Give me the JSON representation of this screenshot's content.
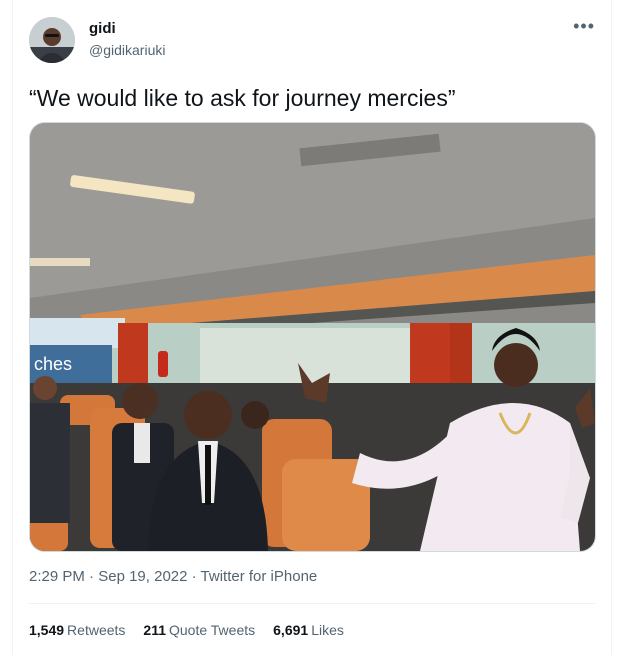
{
  "author": {
    "display_name": "gidi",
    "handle": "@gidikariuki"
  },
  "tweet": {
    "text": "“We would like to ask for journey mercies”",
    "time": "2:29 PM",
    "sep1": "·",
    "date": "Sep 19, 2022",
    "sep2": "·",
    "source": "Twitter for iPhone"
  },
  "more_menu": {
    "icon": "more-dots-icon",
    "glyph": "•••"
  },
  "media": {
    "bus_sign_text": "ches"
  },
  "stats": {
    "retweets_count": "1,549",
    "retweets_label": "Retweets",
    "quotes_count": "211",
    "quotes_label": "Quote Tweets",
    "likes_count": "6,691",
    "likes_label": "Likes"
  },
  "colors": {
    "text_primary": "#0f1419",
    "text_secondary": "#536471",
    "border": "#eff3f4"
  }
}
